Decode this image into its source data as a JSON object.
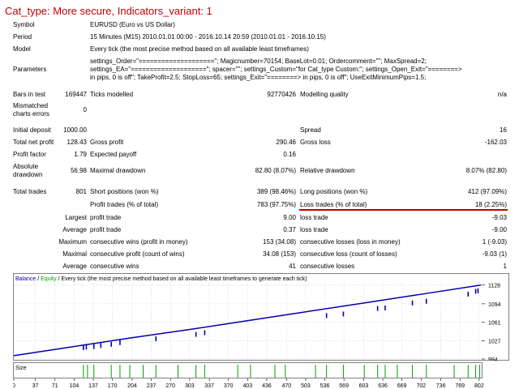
{
  "title": "Cat_type: More secure, Indicators_variant: 1",
  "symbol": {
    "label": "Symbol",
    "value": "EURUSD (Euro vs US Dollar)"
  },
  "period": {
    "label": "Period",
    "value": "15 Minutes (M15) 2010.01.01 00:00 - 2016.10.14 20:59 (2010.01.01 - 2016.10.15)"
  },
  "model": {
    "label": "Model",
    "value": "Every tick (the most precise method based on all available least timeframes)"
  },
  "parameters": {
    "label": "Parameters",
    "line1": "settings_Order=\"====================\"; Magicnumber=70154; BaseLot=0.01; Ordercomment=\"\"; MaxSpread=2;",
    "line2": "settings_EA=\"====================\"; spacer=\"\"; settings_Custom=\"for Cat_type Custom:\"; settings_Open_Exit=\"========>",
    "line3": "in pips, 0 is off\"; TakeProfit=2.5; StopLoss=65; settings_Exit=\"========> in pips, 0 is off\"; UseExitMinimumPips=1.5;"
  },
  "bars": {
    "label": "Bars in test",
    "value": "169447",
    "ticks_label": "Ticks modelled",
    "ticks_value": "92770426",
    "quality_label": "Modelling quality",
    "quality_value": "n/a"
  },
  "mismatch": {
    "label1": "Mismatched",
    "label2": "charts errors",
    "value": "0"
  },
  "deposit": {
    "label": "Initial deposit",
    "value": "1000.00",
    "spread_label": "Spread",
    "spread_value": "16"
  },
  "netprofit": {
    "label": "Total net profit",
    "value": "128.43",
    "gp_label": "Gross profit",
    "gp_value": "290.46",
    "gl_label": "Gross loss",
    "gl_value": "-162.03"
  },
  "pf": {
    "label": "Profit factor",
    "value": "1.79",
    "ep_label": "Expected payoff",
    "ep_value": "0.16"
  },
  "dd": {
    "label1": "Absolute",
    "label2": "drawdown",
    "value": "56.98",
    "max_label": "Maximal drawdown",
    "max_value": "82.80 (8.07%)",
    "rel_label": "Relative drawdown",
    "rel_value": "8.07% (82.80)"
  },
  "trades": {
    "label": "Total trades",
    "value": "801",
    "short_label": "Short positions (won %)",
    "short_value": "389 (98.46%)",
    "long_label": "Long positions (won %)",
    "long_value": "412 (97.09%)"
  },
  "ptrades": {
    "label": "Profit trades (% of total)",
    "value": "783 (97.75%)",
    "loss_label": "Loss trades (% of total)",
    "loss_value": "18 (2.25%)"
  },
  "largest": {
    "label": "Largest",
    "p_label": "profit trade",
    "p_value": "9.00",
    "l_label": "loss trade",
    "l_value": "-9.03"
  },
  "average": {
    "label": "Average",
    "p_label": "profit trade",
    "p_value": "0.37",
    "l_label": "loss trade",
    "l_value": "-9.00"
  },
  "maximum": {
    "label": "Maximum",
    "p_label": "consecutive wins (profit in money)",
    "p_value": "153 (34.08)",
    "l_label": "consecutive losses (loss in money)",
    "l_value": "1 (-9.03)"
  },
  "maximal": {
    "label": "Maximal",
    "p_label": "consecutive profit (count of wins)",
    "p_value": "34.08 (153)",
    "l_label": "consecutive loss (count of losses)",
    "l_value": "-9.03 (1)"
  },
  "average2": {
    "label": "Average",
    "p_label": "consecutive wins",
    "p_value": "41",
    "l_label": "consecutive losses",
    "l_value": "1"
  },
  "chart_legend": {
    "balance": "Balance",
    "slash1": " / ",
    "equity": "Equity",
    "rest": " / Every tick (the most precise method based on all available least timeframes to generate each tick)"
  },
  "size_label": "Size",
  "colors": {
    "balance": "#0000b0",
    "equity": "#00a000",
    "grid": "#c8c8c8",
    "title": "#c00000"
  },
  "chart_data": {
    "type": "line",
    "title": "",
    "y_ticks": [
      994,
      1027,
      1061,
      1094,
      1128
    ],
    "x_ticks": [
      0,
      37,
      71,
      104,
      137,
      170,
      204,
      237,
      270,
      303,
      337,
      370,
      403,
      436,
      470,
      503,
      536,
      569,
      603,
      636,
      669,
      702,
      736,
      769,
      802
    ],
    "ylim": [
      994,
      1132
    ],
    "xlim": [
      0,
      805
    ],
    "series": [
      {
        "name": "Balance",
        "x": [
          0,
          100,
          200,
          300,
          400,
          500,
          600,
          700,
          805
        ],
        "y": [
          1000,
          1016,
          1032,
          1047,
          1063,
          1079,
          1095,
          1111,
          1128
        ]
      }
    ],
    "drawdown_trades": [
      {
        "x": 120,
        "y": 1019
      },
      {
        "x": 125,
        "y": 1020
      },
      {
        "x": 138,
        "y": 1021
      },
      {
        "x": 150,
        "y": 1023
      },
      {
        "x": 168,
        "y": 1025
      },
      {
        "x": 183,
        "y": 1028
      },
      {
        "x": 245,
        "y": 1035
      },
      {
        "x": 314,
        "y": 1043
      },
      {
        "x": 329,
        "y": 1046
      },
      {
        "x": 539,
        "y": 1077
      },
      {
        "x": 568,
        "y": 1080
      },
      {
        "x": 627,
        "y": 1090
      },
      {
        "x": 640,
        "y": 1091
      },
      {
        "x": 687,
        "y": 1100
      },
      {
        "x": 711,
        "y": 1103
      },
      {
        "x": 783,
        "y": 1116
      },
      {
        "x": 796,
        "y": 1121
      },
      {
        "x": 800,
        "y": 1122
      }
    ],
    "size_marks": [
      120,
      127,
      138,
      168,
      183,
      200,
      223,
      245,
      283,
      314,
      329,
      386,
      408,
      450,
      468,
      520,
      539,
      568,
      604,
      627,
      640,
      661,
      687,
      711,
      759,
      783,
      796,
      803
    ]
  }
}
